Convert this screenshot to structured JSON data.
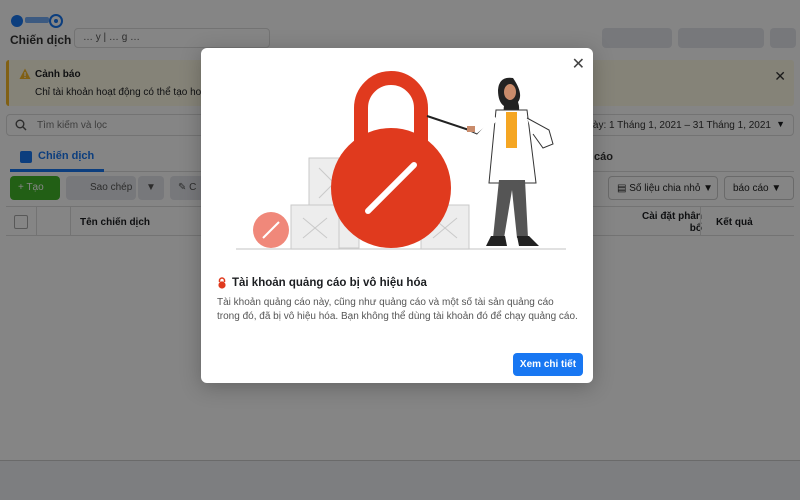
{
  "app": {
    "page_title": "Chiến dịch",
    "account_field": "… y  | … g  …",
    "alert": {
      "title": "Cảnh báo",
      "body": "Chỉ tài khoản hoạt động có thể tạo hoặc c"
    },
    "search": {
      "placeholder": "Tìm kiếm và lọc",
      "date_range": "ng này: 1 Tháng 1, 2021 – 31 Tháng 1, 2021"
    },
    "tabs": {
      "campaign_label": "Chiến dịch",
      "ads_label": "cáo"
    },
    "toolbar": {
      "create_label": "+ Tạo",
      "copy_label": "Sao chép",
      "edit_label": "C",
      "breakdown_label": "Số liệu chia nhỏ",
      "report_label": "báo cáo"
    },
    "table": {
      "col_name": "Tên chiến dịch",
      "col_budget": "Cài đặt phân bổ",
      "col_result": "Kết quả"
    }
  },
  "modal": {
    "title": "Tài khoản quảng cáo bị vô hiệu hóa",
    "body": "Tài khoản quảng cáo này, cũng như quảng cáo và một số tài sản quảng cáo trong đó, đã bị vô hiệu hóa. Bạn không thể dùng tài khoản đó để chạy quảng cáo.",
    "button_label": "Xem chi tiết"
  },
  "colors": {
    "brand_blue": "#1877f2",
    "lock_red": "#e03a1e",
    "warning_yellow": "#f7b928",
    "create_green": "#42b72a"
  }
}
